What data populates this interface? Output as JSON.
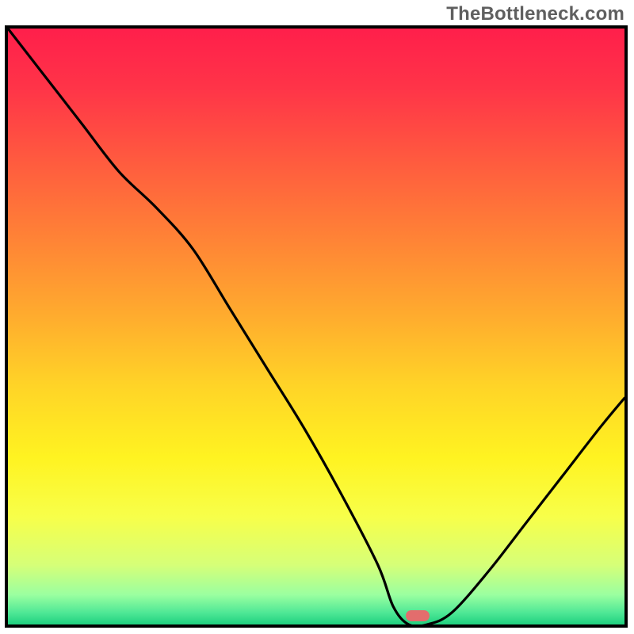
{
  "watermark": "TheBottleneck.com",
  "chart_data": {
    "type": "line",
    "title": "",
    "xlabel": "",
    "ylabel": "",
    "xlim": [
      0,
      100
    ],
    "ylim": [
      0,
      100
    ],
    "grid": false,
    "series": [
      {
        "name": "bottleneck-curve",
        "x": [
          0,
          6,
          12,
          18,
          24,
          30,
          36,
          42,
          48,
          54,
          60,
          62.5,
          65,
          68,
          72,
          78,
          84,
          90,
          96,
          100
        ],
        "y": [
          100,
          92,
          84,
          76,
          70,
          63,
          53,
          43,
          33,
          22,
          10,
          3,
          0,
          0,
          2,
          9,
          17,
          25,
          33,
          38
        ]
      }
    ],
    "marker": {
      "x": 66.5,
      "y": 1.5,
      "color": "#e36d6d"
    },
    "background_gradient": {
      "stops": [
        {
          "pct": 0,
          "color": "#ff1f4b"
        },
        {
          "pct": 10,
          "color": "#ff3448"
        },
        {
          "pct": 22,
          "color": "#ff5a3f"
        },
        {
          "pct": 35,
          "color": "#ff8236"
        },
        {
          "pct": 48,
          "color": "#ffab2e"
        },
        {
          "pct": 60,
          "color": "#ffd427"
        },
        {
          "pct": 72,
          "color": "#fff321"
        },
        {
          "pct": 82,
          "color": "#f7ff4a"
        },
        {
          "pct": 90,
          "color": "#d6ff78"
        },
        {
          "pct": 95,
          "color": "#9bffa0"
        },
        {
          "pct": 98,
          "color": "#4fe896"
        },
        {
          "pct": 100,
          "color": "#1fd07f"
        }
      ]
    }
  }
}
